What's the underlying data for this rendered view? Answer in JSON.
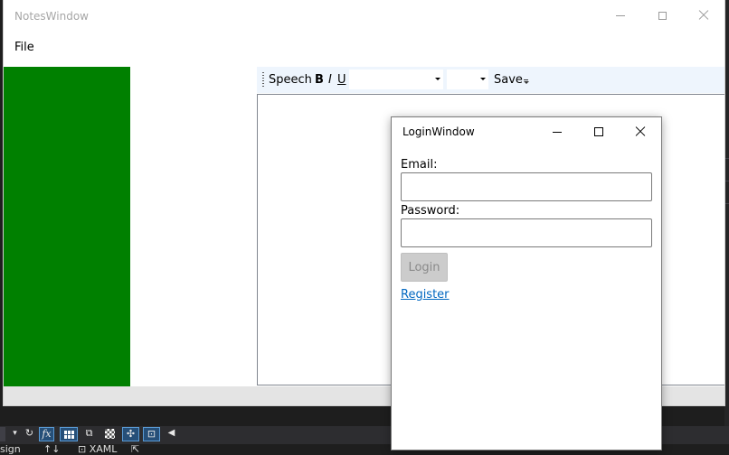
{
  "notes_window": {
    "title": "NotesWindow",
    "menu": {
      "file": "File"
    },
    "toolbar": {
      "speech_label": "Speech",
      "bold_label": "B",
      "italic_label": "I",
      "underline_label": "U",
      "font_family_value": "",
      "font_size_value": "",
      "save_label": "Save"
    },
    "colors": {
      "left_panel": "#008000",
      "toolbar_bg": "#eef5fd"
    }
  },
  "login_window": {
    "title": "LoginWindow",
    "email_label": "Email:",
    "email_value": "",
    "password_label": "Password:",
    "password_value": "",
    "login_button_label": "Login",
    "register_link": "Register",
    "colors": {
      "link": "#0067c0",
      "disabled_button": "#cccccc"
    }
  },
  "ide": {
    "toolbar_icons": [
      "refresh-icon",
      "fx-icon",
      "grid-icon",
      "measure-icon",
      "checkerboard-icon",
      "snap-icon",
      "layout-icon",
      "scroll-left-icon"
    ],
    "fx_label": "fx",
    "status": {
      "design_tab": "sign",
      "swap_icon": "↑↓",
      "xaml_tab": "XAML"
    }
  }
}
